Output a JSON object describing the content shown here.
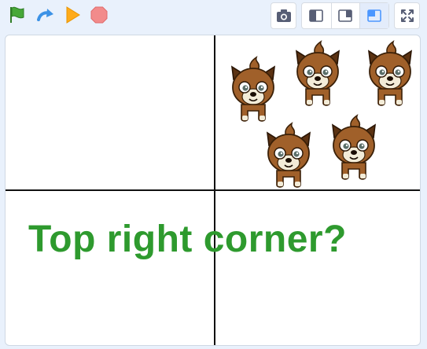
{
  "toolbar": {
    "icons": [
      "green-flag-icon",
      "redo-arrow-icon",
      "orange-triangle-icon",
      "stop-octagon-icon"
    ],
    "right_icons": [
      "camera-icon",
      "small-stage-layout-icon",
      "large-stage-layout-icon",
      "corner-stage-layout-icon",
      "fullscreen-icon"
    ]
  },
  "stage": {
    "caption": "Top right corner?",
    "caption_color": "#2e9a2e",
    "sprite": "brown-dog-sprite",
    "sprite_count": 5
  },
  "colors": {
    "flag": "#47a838",
    "arrow": "#3c92e6",
    "go": "#ffab1a",
    "stop": "#f28b8b",
    "dog_fur": "#a0602a",
    "dog_dark": "#5b3212"
  }
}
